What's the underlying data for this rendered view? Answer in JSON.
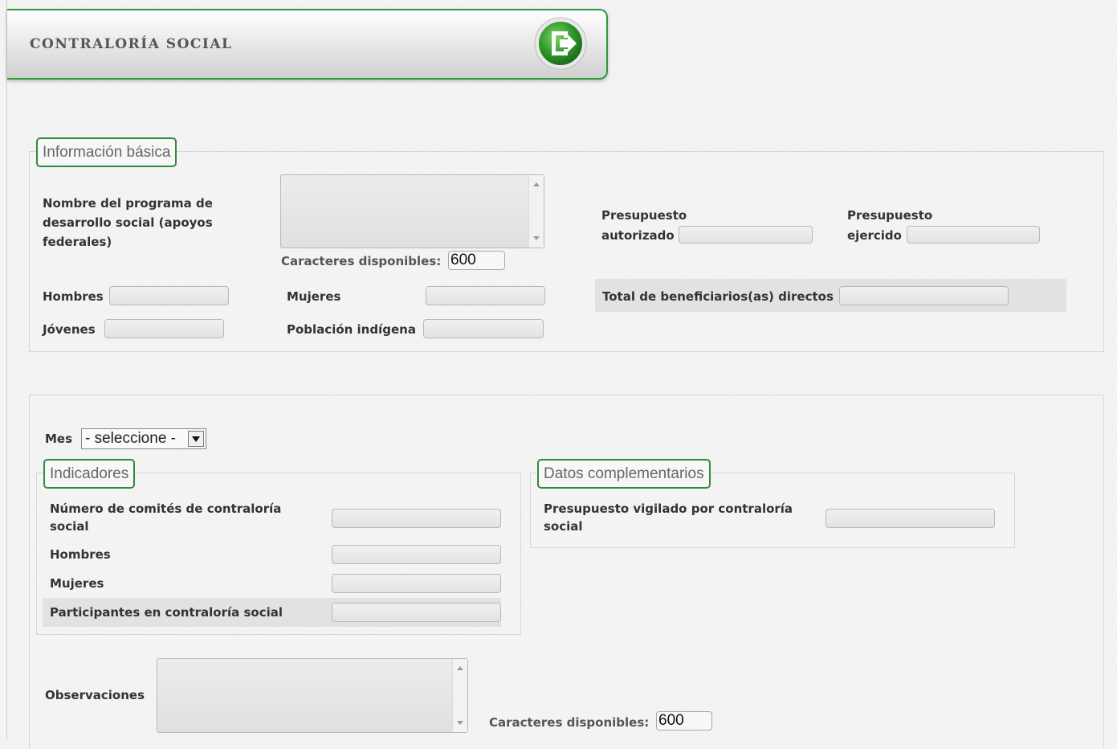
{
  "header": {
    "title": "CONTRALORÍA SOCIAL",
    "exit_icon": "exit-door-icon",
    "accent_color": "#2f9a3c"
  },
  "basic_info": {
    "legend": "Información básica",
    "program_name_label": "Nombre del programa de desarrollo social (apoyos federales)",
    "program_name_value": "",
    "chars_available_label": "Caracteres disponibles:",
    "chars_available_value": "600",
    "budget_authorized_label_1": "Presupuesto",
    "budget_authorized_label_2": "autorizado",
    "budget_authorized_value": "",
    "budget_spent_label_1": "Presupuesto",
    "budget_spent_label_2": "ejercido",
    "budget_spent_value": "",
    "men_label": "Hombres",
    "men_value": "",
    "women_label": "Mujeres",
    "women_value": "",
    "total_beneficiaries_label": "Total de beneficiarios(as) directos",
    "total_beneficiaries_value": "",
    "youth_label": "Jóvenes",
    "youth_value": "",
    "indigenous_label": "Población indígena",
    "indigenous_value": ""
  },
  "monthly": {
    "month_label": "Mes",
    "month_selected": "- seleccione -",
    "indicators": {
      "legend": "Indicadores",
      "committees_label": "Número de comités de contraloría social",
      "committees_value": "",
      "men_label": "Hombres",
      "men_value": "",
      "women_label": "Mujeres",
      "women_value": "",
      "participants_label": "Participantes en contraloría social",
      "participants_value": ""
    },
    "complementary": {
      "legend": "Datos complementarios",
      "budget_watched_label": "Presupuesto vigilado por contraloría social",
      "budget_watched_value": ""
    },
    "observations_label": "Observaciones",
    "observations_value": "",
    "chars_available_label": "Caracteres disponibles:",
    "chars_available_value": "600"
  }
}
